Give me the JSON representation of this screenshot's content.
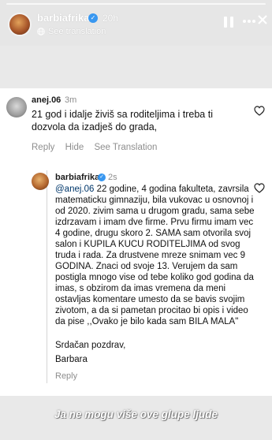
{
  "story": {
    "username": "barbiafrika",
    "time": "20h",
    "see_translation": "See translation",
    "icons": [
      "pause-icon",
      "more-icon",
      "close-icon",
      "globe-icon"
    ]
  },
  "comment1": {
    "username": "anej.06",
    "time": "3m",
    "text": "21 god i idalje živiš sa roditeljima i treba ti dozvola da izadješ do grada,",
    "actions": {
      "reply": "Reply",
      "hide": "Hide",
      "see_translation": "See Translation"
    }
  },
  "comment2": {
    "username": "barbiafrika",
    "time": "2s",
    "mention": "@anej.06",
    "text": " 22 godine, 4 godina fakulteta, zavrsila matematicku gimnaziju, bila vukovac u osnovnoj i od 2020. zivim sama u drugom gradu, sama sebe izdrzavam i imam dve firme. Prvu firmu imam vec 4 godine, drugu skoro 2. SAMA sam otvorila svoj salon i KUPILA KUCU RODITELJIMA od svog truda i rada. Za drustvene mreze snimam vec 9 GODINA. Znaci od svoje 13. Verujem da sam postigla mnogo vise od tebe koliko god godina da imas, s obzirom da imas vremena da meni ostavljas komentare umesto da se bavis svojim zivotom, a da si pametan procitao bi opis i video da pise ,,Ovako je bilo kada sam BILA MALA\"",
    "greeting": "Srdačan pozdrav,",
    "signature": "Barbara",
    "reply": "Reply"
  },
  "caption": "Ja ne mogu više ove glupe ljude",
  "colors": {
    "verified": "#3897f0",
    "mention": "#00376b",
    "muted": "#8e8e8e"
  }
}
